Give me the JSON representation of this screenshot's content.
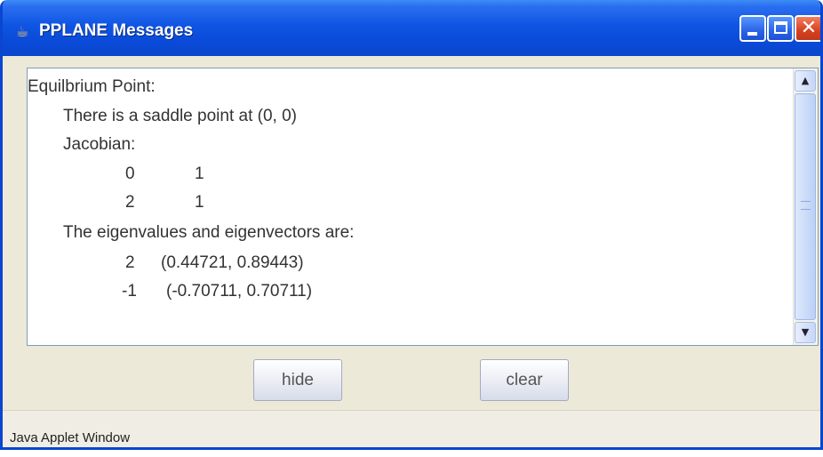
{
  "window": {
    "title": "PPLANE Messages",
    "icon": "java-cup-icon"
  },
  "titlebar_buttons": [
    "minimize-icon",
    "maximize-icon",
    "close-icon"
  ],
  "message_lines": [
    "Equilbrium Point:",
    "There is a saddle point at (0, 0)",
    "Jacobian:",
    "0",
    "1",
    "2",
    "1",
    "The eigenvalues and eigenvectors are:",
    "2",
    "(0.44721, 0.89443)",
    "-1",
    "(-0.70711, 0.70711)"
  ],
  "buttons": {
    "hide": "hide",
    "clear": "clear"
  },
  "status": {
    "text": "Java Applet Window"
  },
  "colors": {
    "titlebar": "#0a4ad8",
    "window_bg": "#ece9d8",
    "close_button": "#d84020"
  }
}
